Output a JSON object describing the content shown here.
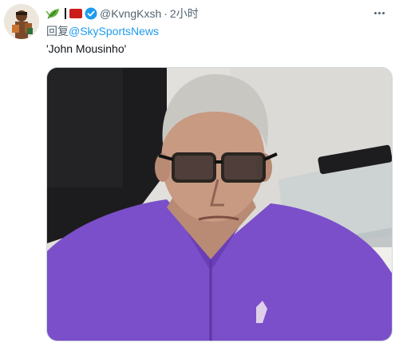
{
  "tweet": {
    "handle": "@KvngKxsh",
    "separator": "·",
    "time": "2小时",
    "reply_prefix": "回复",
    "reply_to": "@SkySportsNews",
    "text": "'John Mousinho'"
  },
  "icons": {
    "avatar": "user-avatar",
    "leaf": "leaf-emoji-icon",
    "flag": "red-flag-emoji-icon",
    "verified": "verified-badge-icon",
    "more": "more-options-icon"
  },
  "colors": {
    "link": "#1d9bf0",
    "muted": "#536471",
    "shirt": "#7b4fc9"
  }
}
